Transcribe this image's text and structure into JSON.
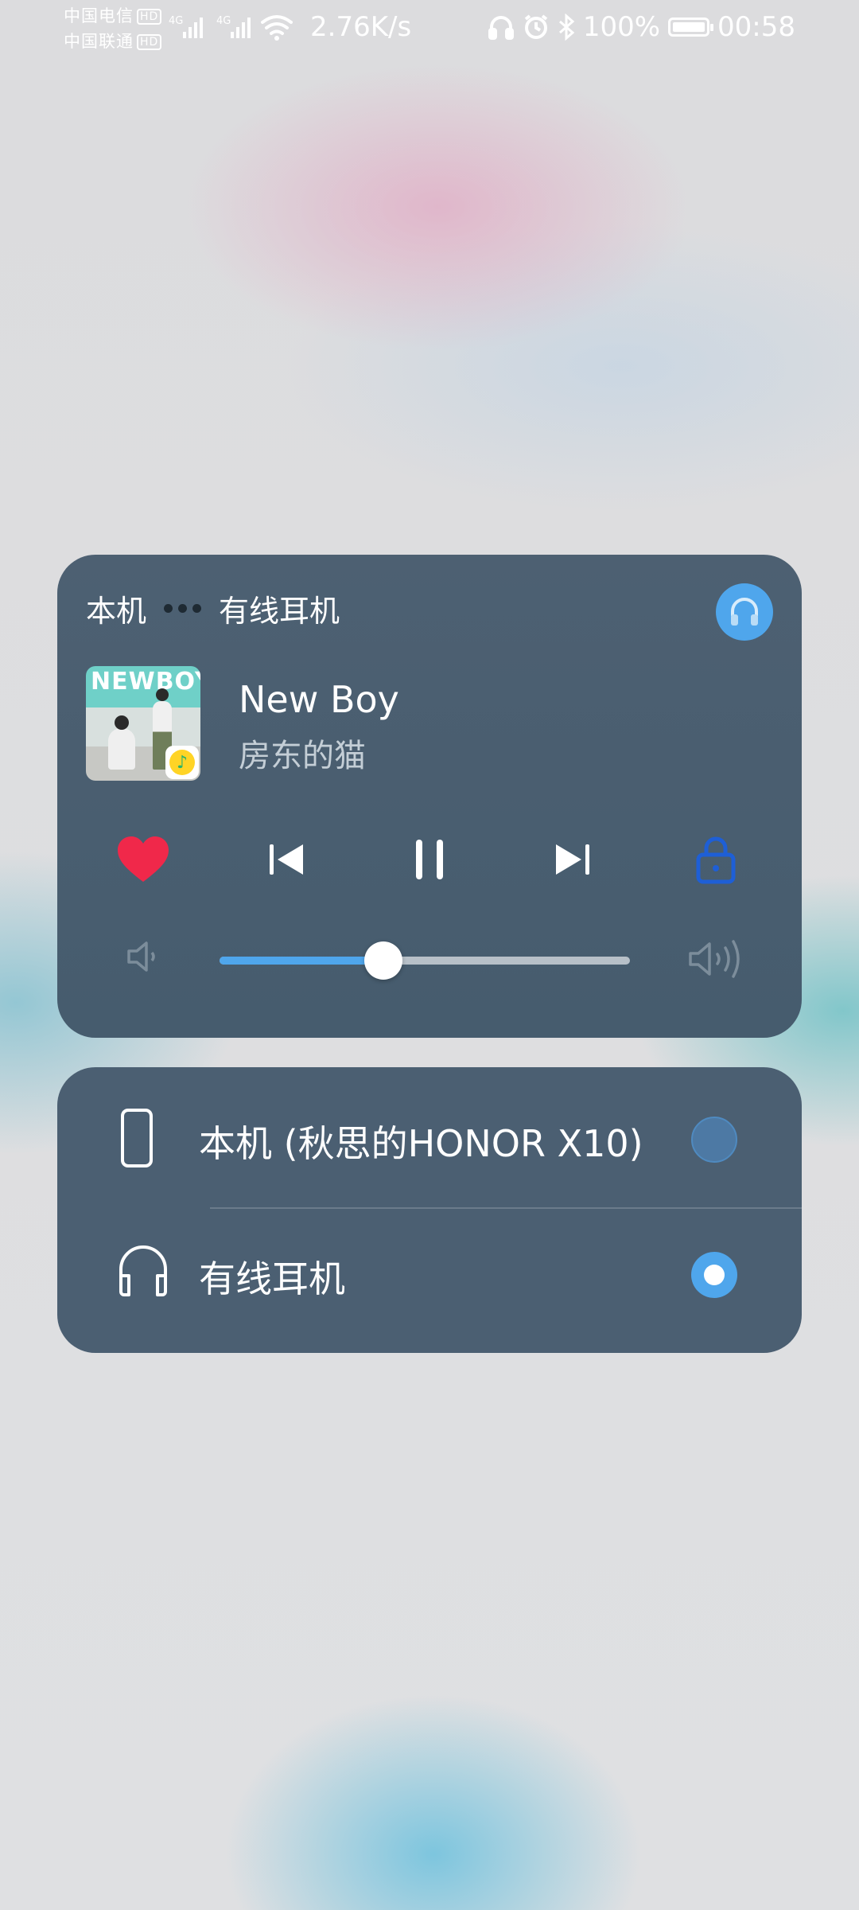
{
  "status_bar": {
    "carrier1": "中国电信",
    "carrier2": "中国联通",
    "hd_label": "HD",
    "net_type": "4G",
    "net_speed": "2.76K/s",
    "battery": "100%",
    "time": "00:58",
    "icons": [
      "signal-icon",
      "wifi-icon",
      "headphones-icon",
      "alarm-icon",
      "bluetooth-icon",
      "battery-icon"
    ]
  },
  "player": {
    "route_source": "本机",
    "route_target": "有线耳机",
    "album_art_text": "NEWBOY",
    "song_title": "New Boy",
    "artist": "房东的猫",
    "volume_fraction": 0.4,
    "playing": true,
    "liked": true,
    "colors": {
      "accent": "#4fa6ec",
      "heart": "#f0284a",
      "lock": "#1e5fd6",
      "card": "#4a5e70"
    }
  },
  "outputs": {
    "items": [
      {
        "label": "本机 (秋思的HONOR X10)",
        "icon": "phone-icon",
        "selected": false
      },
      {
        "label": "有线耳机",
        "icon": "headphones-icon",
        "selected": true
      }
    ]
  }
}
